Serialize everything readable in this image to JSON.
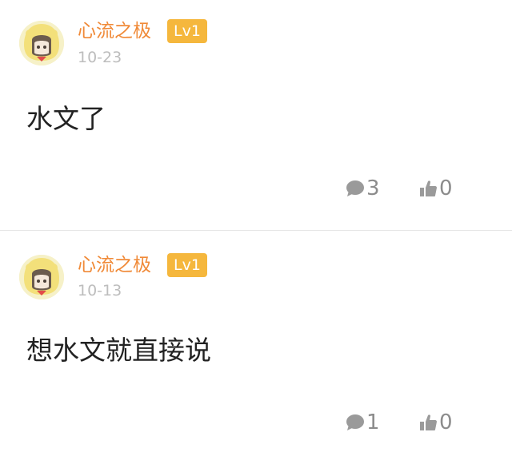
{
  "posts": [
    {
      "username": "心流之极",
      "level": "Lv1",
      "time": "10-23",
      "content": "水文了",
      "comments": "3",
      "likes": "0"
    },
    {
      "username": "心流之极",
      "level": "Lv1",
      "time": "10-13",
      "content": "想水文就直接说",
      "comments": "1",
      "likes": "0"
    }
  ],
  "icons": {
    "comment": "comment-bubble-icon",
    "like": "thumbs-up-icon"
  },
  "colors": {
    "username": "#f08a38",
    "level_badge": "#f5b73d",
    "time": "#bdbdbd",
    "action": "#8c8c8c"
  }
}
